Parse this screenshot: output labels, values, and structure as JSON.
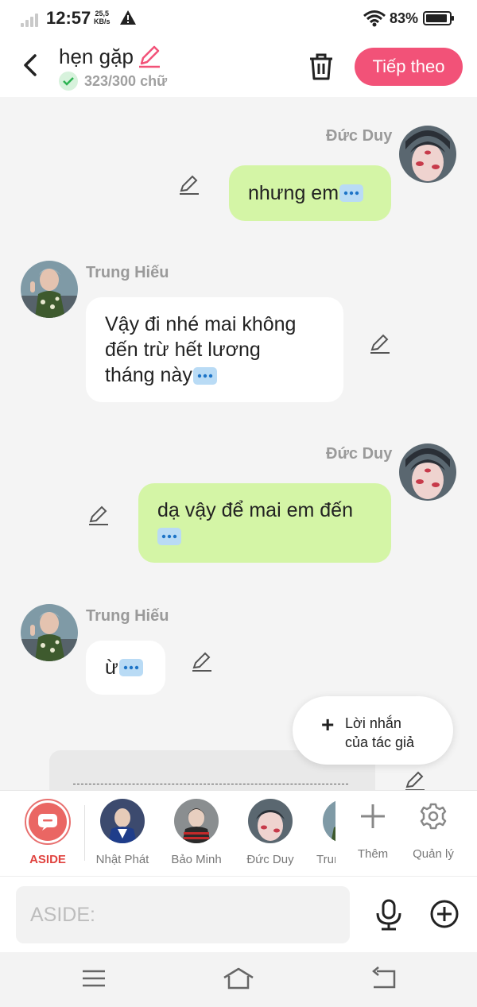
{
  "status_bar": {
    "time": "12:57",
    "net_speed_value": "25,5",
    "net_speed_unit": "KB/s",
    "battery_percent": "83%",
    "icons": [
      "signal-icon",
      "warning-icon",
      "wifi-icon",
      "battery-icon"
    ]
  },
  "header": {
    "title": "hẹn gặp",
    "char_count": "323/300 chữ",
    "next_label": "Tiếp theo",
    "accent_color": "#f25278"
  },
  "messages": [
    {
      "sender": "Đức Duy",
      "side": "right",
      "text": "nhưng em"
    },
    {
      "sender": "Trung Hiếu",
      "side": "left",
      "lines": [
        "Vậy đi nhé mai không",
        "đến trừ hết lương",
        "tháng này"
      ]
    },
    {
      "sender": "Đức Duy",
      "side": "right",
      "lines": [
        "dạ vậy để mai em đến",
        ""
      ]
    },
    {
      "sender": "Trung Hiếu",
      "side": "left",
      "text": "ừ"
    }
  ],
  "author_note": {
    "line1": "Lời nhắn",
    "line2": "của tác giả",
    "plus": "+"
  },
  "characters": [
    {
      "label": "ASIDE",
      "active": true
    },
    {
      "label": "Nhật Phát"
    },
    {
      "label": "Bảo Minh"
    },
    {
      "label": "Đức Duy"
    },
    {
      "label": "Trung Hiếu"
    }
  ],
  "tools": {
    "add_label": "Thêm",
    "manage_label": "Quản lý"
  },
  "input": {
    "placeholder": "ASIDE:"
  },
  "colors": {
    "me_bubble": "#d4f5a6",
    "them_bubble": "#ffffff",
    "aside": "#ea6663",
    "background": "#f4f4f4"
  }
}
